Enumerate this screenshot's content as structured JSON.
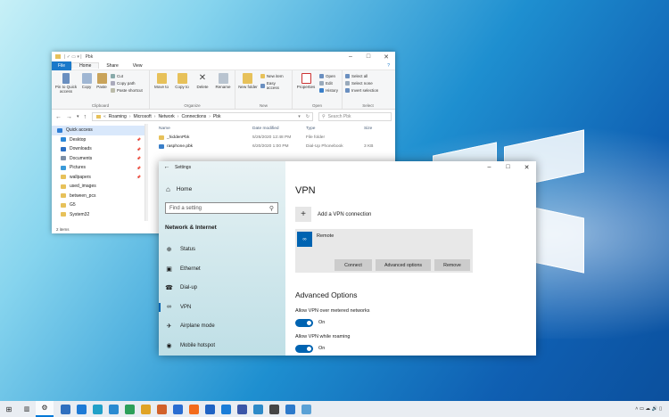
{
  "explorer": {
    "title": "Pbk",
    "tabs": [
      "File",
      "Home",
      "Share",
      "View"
    ],
    "ribbon": {
      "clipboard": {
        "name": "Clipboard",
        "pin": "Pin to Quick access",
        "copy": "Copy",
        "paste": "Paste",
        "cut": "Cut",
        "copy_path": "Copy path",
        "paste_shortcut": "Paste shortcut"
      },
      "organize": {
        "name": "Organize",
        "move_to": "Move to",
        "copy_to": "Copy to",
        "delete": "Delete",
        "rename": "Rename"
      },
      "new": {
        "name": "New",
        "new_folder": "New folder",
        "new_item": "New item",
        "easy_access": "Easy access"
      },
      "open": {
        "name": "Open",
        "properties": "Properties",
        "open": "Open",
        "edit": "Edit",
        "history": "History"
      },
      "select": {
        "name": "Select",
        "select_all": "Select all",
        "select_none": "Select none",
        "invert": "Invert selection"
      }
    },
    "address": {
      "crumbs": [
        "Roaming",
        "Microsoft",
        "Network",
        "Connections",
        "Pbk"
      ],
      "search_placeholder": "Search Pbk"
    },
    "nav": [
      {
        "label": "Quick access",
        "color": "#2f7fd6",
        "pin": false
      },
      {
        "label": "Desktop",
        "color": "#2b88d8",
        "pin": true
      },
      {
        "label": "Downloads",
        "color": "#2b6fc4",
        "pin": true
      },
      {
        "label": "Documents",
        "color": "#7b8ea6",
        "pin": true
      },
      {
        "label": "Pictures",
        "color": "#3a9ad9",
        "pin": true
      },
      {
        "label": "wallpapers",
        "color": "#e7c15a",
        "pin": true
      },
      {
        "label": "used_images",
        "color": "#e7c15a",
        "pin": false
      },
      {
        "label": "between_pcs",
        "color": "#e7c15a",
        "pin": false
      },
      {
        "label": "G5",
        "color": "#e7c15a",
        "pin": false
      },
      {
        "label": "System32",
        "color": "#e7c15a",
        "pin": false
      }
    ],
    "columns": {
      "name": "Name",
      "date": "Date modified",
      "type": "Type",
      "size": "Size"
    },
    "files": [
      {
        "name": "_hiddenPbk",
        "date": "5/26/2020 12:48 PM",
        "type": "File folder",
        "size": "",
        "color": "#e7c15a"
      },
      {
        "name": "rasphone.pbk",
        "date": "6/20/2020 1:00 PM",
        "type": "Dial-Up Phonebook",
        "size": "3 KB",
        "color": "#3a7fc9"
      }
    ],
    "status": "2 items"
  },
  "settings": {
    "title": "Settings",
    "home": "Home",
    "search_placeholder": "Find a setting",
    "section": "Network & Internet",
    "nav": [
      {
        "label": "Status",
        "icon": "⊕",
        "active": false
      },
      {
        "label": "Ethernet",
        "icon": "▣",
        "active": false
      },
      {
        "label": "Dial-up",
        "icon": "☎",
        "active": false
      },
      {
        "label": "VPN",
        "icon": "∞",
        "active": true
      },
      {
        "label": "Airplane mode",
        "icon": "✈",
        "active": false
      },
      {
        "label": "Mobile hotspot",
        "icon": "◉",
        "active": false
      }
    ],
    "page_title": "VPN",
    "add_vpn": "Add a VPN connection",
    "connection": {
      "name": "Remote",
      "connect": "Connect",
      "advanced": "Advanced options",
      "remove": "Remove"
    },
    "advanced_title": "Advanced Options",
    "options": [
      {
        "label": "Allow VPN over metered networks",
        "state": "On"
      },
      {
        "label": "Allow VPN while roaming",
        "state": "On"
      }
    ]
  },
  "taskbar": {
    "icons": [
      "#2f6fbf",
      "#1d7ad6",
      "#21a0c8",
      "#2a8ad1",
      "#2da05a",
      "#e0a325",
      "#d2612a",
      "#2a6dd1",
      "#f36b1c",
      "#1f63c4",
      "#1a7dd8",
      "#3b56a8",
      "#2d8ac8",
      "#454545",
      "#2d7acb",
      "#5aa1d6"
    ],
    "tray": "˄  ▭  ☁  🔊  ▯"
  }
}
